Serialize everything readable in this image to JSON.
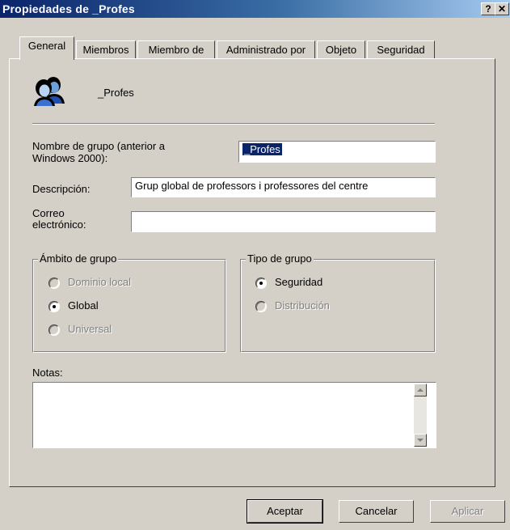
{
  "window": {
    "title": "Propiedades de _Profes",
    "help_label": "?",
    "close_label": "✕"
  },
  "tabs": [
    {
      "label": "General"
    },
    {
      "label": "Miembros"
    },
    {
      "label": "Miembro de"
    },
    {
      "label": "Administrado por"
    },
    {
      "label": "Objeto"
    },
    {
      "label": "Seguridad"
    }
  ],
  "group": {
    "icon": "users-group-icon",
    "name": "_Profes"
  },
  "form": {
    "prewin_label_line1": "Nombre de grupo (anterior a",
    "prewin_label_line2": "Windows 2000):",
    "prewin_value": "_Profes",
    "description_label": "Descripción:",
    "description_value": "Grup global de professors i professores del centre",
    "email_label_line1": "Correo",
    "email_label_line2": "electrónico:",
    "email_value": ""
  },
  "scope": {
    "legend": "Ámbito de grupo",
    "options": [
      {
        "label": "Dominio local",
        "selected": false,
        "enabled": false
      },
      {
        "label": "Global",
        "selected": true,
        "enabled": true
      },
      {
        "label": "Universal",
        "selected": false,
        "enabled": false
      }
    ]
  },
  "type": {
    "legend": "Tipo de grupo",
    "options": [
      {
        "label": "Seguridad",
        "selected": true,
        "enabled": true
      },
      {
        "label": "Distribución",
        "selected": false,
        "enabled": false
      }
    ]
  },
  "notes": {
    "label": "Notas:",
    "value": ""
  },
  "buttons": {
    "ok": "Aceptar",
    "cancel": "Cancelar",
    "apply": "Aplicar"
  }
}
